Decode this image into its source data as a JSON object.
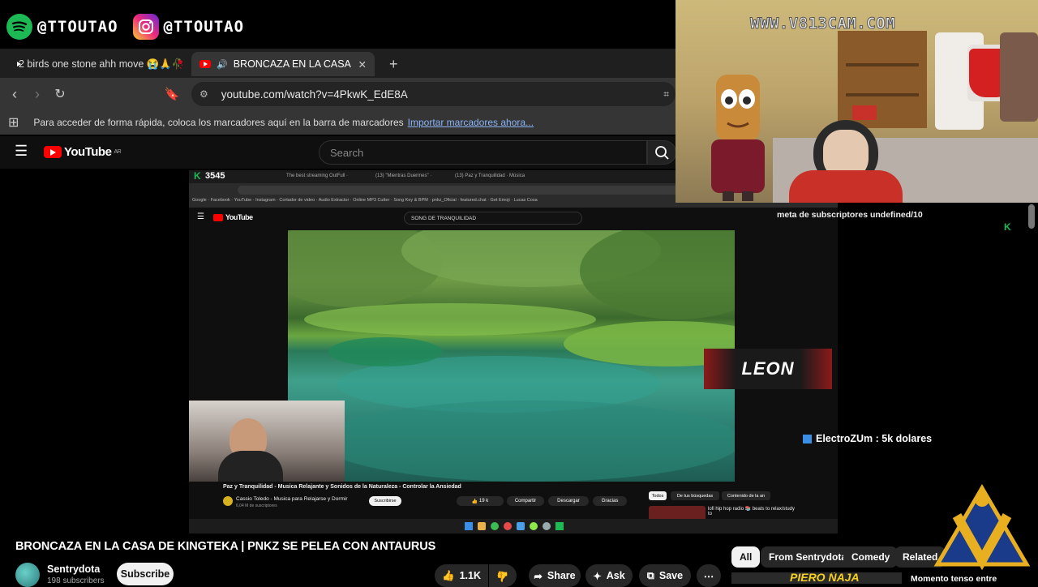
{
  "overlay": {
    "spotify_handle": "@TTOUTAO",
    "instagram_handle": "@TTOUTAO",
    "cam_watermark": "WWW.V813CAM.COM",
    "subs_goal": "meta de subscriptores undefined/10",
    "donation": "ElectroZUm : 5k dolares",
    "name_tag": "LEON",
    "inner_count": "3545"
  },
  "browser": {
    "tabs": [
      {
        "label": "2 birds one stone ahh move 😭🙏🥀",
        "active": false
      },
      {
        "label": "BRONCAZA EN LA CASA DE KINGTEKA",
        "active": true
      }
    ],
    "new_tab": "+",
    "url": "youtube.com/watch?v=4PkwK_EdE8A",
    "bookmarks_text": "Para acceder de forma rápida, coloca los marcadores aquí en la barra de marcadores",
    "bookmarks_link": "Importar marcadores ahora..."
  },
  "youtube": {
    "logo": "YouTube",
    "logo_sup": "AR",
    "search_placeholder": "Search",
    "video_title": "BRONCAZA EN LA CASA DE KINGTEKA | PNKZ SE PELEA CON ANTAURUS",
    "channel": "Sentrydota",
    "subscribers": "198 subscribers",
    "subscribe": "Subscribe",
    "likes": "1.1K",
    "share": "Share",
    "ask": "Ask",
    "save": "Save",
    "more": "⋯",
    "chips": [
      "All",
      "From Sentrydota",
      "Comedy",
      "Related"
    ],
    "related_title": "Momento tenso entre",
    "related_thumb_text": "PIERO ÑAJA"
  },
  "inner": {
    "search": "SONG DE TRANQUILIDAD",
    "video_title": "Paz y Tranquilidad - Musica Relajante y Sonidos de la Naturaleza - Controlar la Ansiedad",
    "channel": "Cassio Toledo - Musica para Relajarse y Dormir",
    "subs": "6,04 M de suscriptores",
    "subscribe": "Suscribirse",
    "likes": "19 k",
    "share": "Compartir",
    "download": "Descargar",
    "thanks": "Gracias",
    "chips": [
      "Todos",
      "De tus búsquedas",
      "Contenido de la an"
    ],
    "side_title": "lofi hip hop radio 📚 beats to relax/study to"
  }
}
